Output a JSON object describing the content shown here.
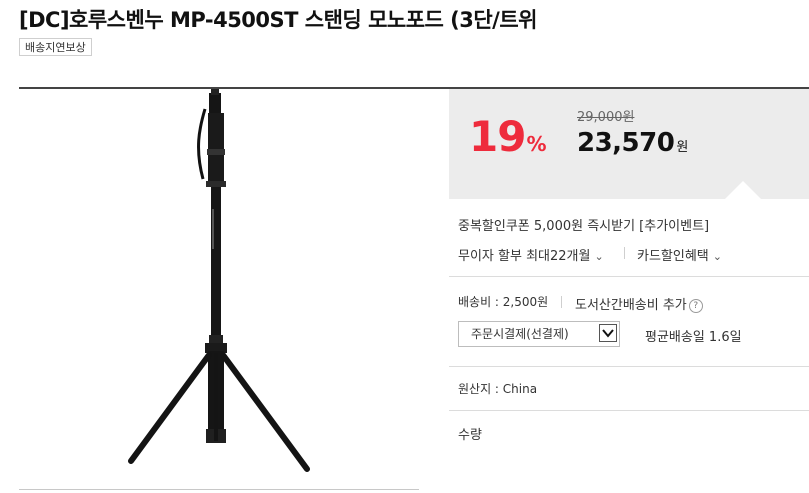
{
  "product": {
    "title": "[DC]호루스벤누 MP-4500ST 스탠딩 모노포드 (3단/트위",
    "badge": "배송지연보상",
    "image_label": "monopod with tripod stand"
  },
  "price": {
    "discount_number": "19",
    "discount_unit": "%",
    "original": "29,000원",
    "sale_number": "23,570",
    "sale_unit": "원",
    "accent_color": "#ee2b3c"
  },
  "benefits": {
    "coupon": "중복할인쿠폰 5,000원 즉시받기 [추가이벤트]",
    "installment": "무이자 할부 최대22개월",
    "card_discount": "카드할인혜택"
  },
  "shipping": {
    "fee": "배송비 : 2,500원",
    "island_fee": "도서산간배송비 추가",
    "payment_option": "주문시결제(선결제)",
    "avg_delivery": "평균배송일 1.6일"
  },
  "origin": "원산지 : China",
  "quantity_label": "수량"
}
